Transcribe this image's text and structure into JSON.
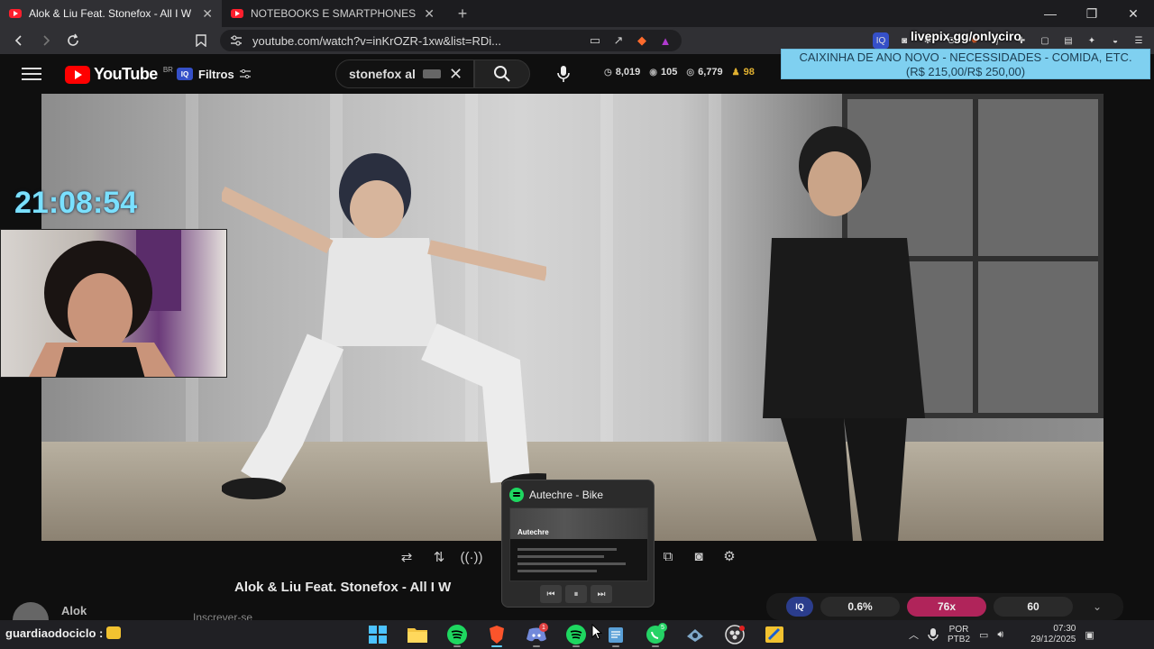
{
  "browser": {
    "tabs": [
      {
        "title": "Alok & Liu Feat. Stonefox - All I W",
        "active": true
      },
      {
        "title": "NOTEBOOKS E SMARTPHONES VÃO",
        "active": false
      }
    ],
    "url": "youtube.com/watch?v=inKrOZR-1xw&list=RDi..."
  },
  "youtube": {
    "logo_text": "YouTube",
    "region": "BR",
    "filters_label": "Filtros",
    "filters_badge": "IQ",
    "search_value": "stonefox al",
    "stats": {
      "views": "8,019",
      "eye": "105",
      "likes": "6,779",
      "gold": "98"
    }
  },
  "overlay": {
    "livepix": "livepix.gg/onlyciro",
    "goal_line1": "CAIXINHA DE ANO NOVO - NECESSIDADES - COMIDA, ETC.",
    "goal_line2": "(R$ 215,00/R$ 250,00)",
    "clock": "21:08:54"
  },
  "video": {
    "title": "Alok & Liu Feat. Stonefox - All I W",
    "channel": "Alok",
    "subscribe_ghost": "Inscrever-se"
  },
  "speed_panel": {
    "badge": "IQ",
    "values": [
      "0.6%",
      "76x",
      "60"
    ]
  },
  "spotify": {
    "track": "Autechre - Bike",
    "thumb_title": "Autechre"
  },
  "taskbar": {
    "chat": "guardiaodociclo :",
    "discord_badge": "1",
    "whatsapp_badge": "5",
    "lang_line1": "POR",
    "lang_line2": "PTB2",
    "time": "07:30",
    "date": "29/12/2025"
  },
  "colors": {
    "accent_cyan": "#7ae0ff",
    "goal_bg": "#7fd0f0",
    "speed_hot": "#b0245a",
    "youtube_red": "#ff0000",
    "spotify_green": "#1ed760"
  }
}
